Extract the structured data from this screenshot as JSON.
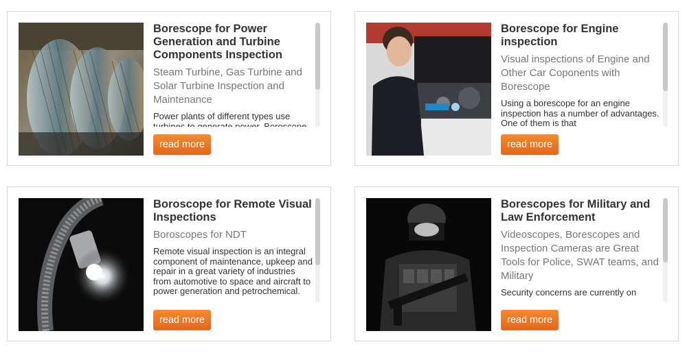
{
  "cards": [
    {
      "title": "Borescope for Power Generation and Turbine Components Inspection",
      "subtitle": "Steam Turbine, Gas Turbine and Solar Turbine Inspection and Maintenance",
      "body": "Power plants of different types use turbines to generate power. Boroscope inspection helps detect defects early.",
      "button": "read more",
      "image": "turbine-rotor-photo"
    },
    {
      "title": "Borescope for Engine inspection",
      "subtitle": "Visual inspections of Engine and Other Car Coponents with Borescope",
      "body": "Using a borescope for an engine inspection has a number of advantages. One of them is that",
      "button": "read more",
      "image": "mechanic-engine-photo"
    },
    {
      "title": "Boroscope for Remote Visual Inspections",
      "subtitle": "Boroscopes for NDT",
      "body": "Remote visual inspection is an integral component of maintenance, upkeep and repair in a great variety of industries from automotive to space and aircraft to power generation and petrochemical.",
      "button": "read more",
      "image": "borescope-probe-photo"
    },
    {
      "title": "Borescopes for Military and Law Enforcement",
      "subtitle": "Videoscopes, Borescopes and Inspection Cameras are Great Tools for Police, SWAT teams, and Military",
      "body": "Security concerns are currently on",
      "button": "read more",
      "image": "swat-officer-photo"
    }
  ],
  "colors": {
    "button": "#ee7722",
    "title": "#333333",
    "subtitle": "#777777",
    "border": "#d6d6d6"
  }
}
